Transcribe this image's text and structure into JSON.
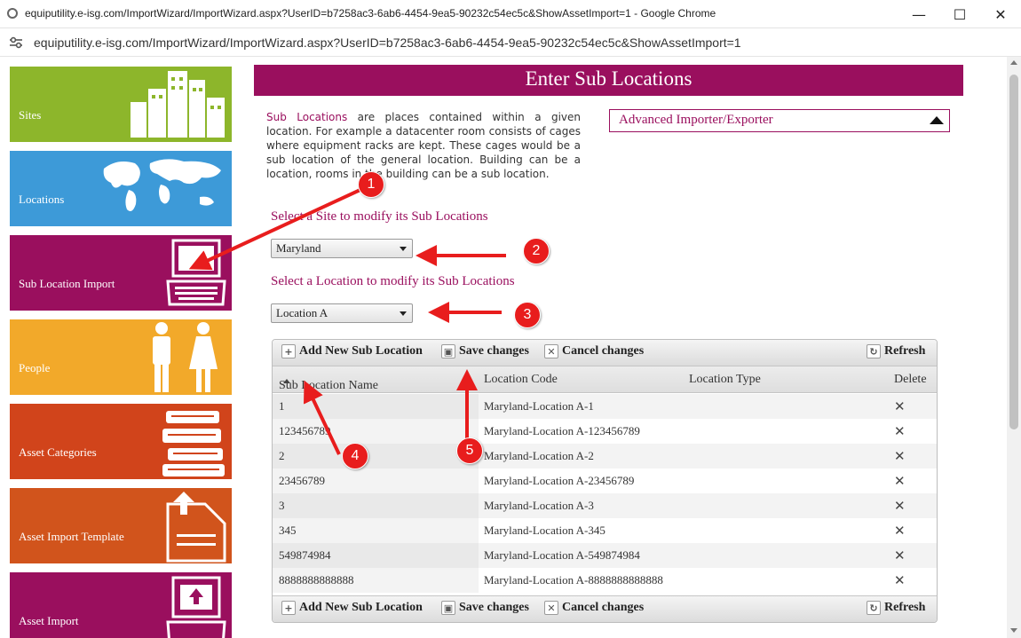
{
  "browser": {
    "window_title": "equiputility.e-isg.com/ImportWizard/ImportWizard.aspx?UserID=b7258ac3-6ab6-4454-9ea5-90232c54ec5c&ShowAssetImport=1 - Google Chrome",
    "url": "equiputility.e-isg.com/ImportWizard/ImportWizard.aspx?UserID=b7258ac3-6ab6-4454-9ea5-90232c54ec5c&ShowAssetImport=1",
    "controls": {
      "minimize": "—",
      "maximize": "☐",
      "close": "✕"
    }
  },
  "sidebar": {
    "tiles": [
      {
        "label": "Sites",
        "color": "#8db62b",
        "icon": "buildings-icon"
      },
      {
        "label": "Locations",
        "color": "#3d9ad8",
        "icon": "world-map-icon"
      },
      {
        "label": "Sub Location Import",
        "color": "#9a0f5e",
        "icon": "computer-icon"
      },
      {
        "label": "People",
        "color": "#f2a92a",
        "icon": "people-icon"
      },
      {
        "label": "Asset Categories",
        "color": "#d1441b",
        "icon": "books-icon"
      },
      {
        "label": "Asset Import Template",
        "color": "#d1541c",
        "icon": "upload-document-icon"
      },
      {
        "label": "Asset Import",
        "color": "#9a0f5e",
        "icon": "upload-computer-icon"
      }
    ]
  },
  "main": {
    "title": "Enter Sub Locations",
    "intro": {
      "link_text": "Sub Locations",
      "text": " are places contained within a given location. For example a datacenter room consists of cages where equipment racks are kept. These cages would be a sub location of the general location. Building can be a location, rooms in the building can be a sub location."
    },
    "advanced": {
      "label": "Advanced Importer/Exporter"
    },
    "site_prompt": "Select a Site to modify its Sub Locations",
    "site_value": "Maryland",
    "location_prompt": "Select a Location to modify its Sub Locations",
    "location_value": "Location A",
    "toolbar": {
      "add": "Add New Sub Location",
      "save": "Save changes",
      "cancel": "Cancel changes",
      "refresh": "Refresh"
    },
    "columns": [
      "Sub Location Name",
      "Location Code",
      "Location Type",
      "Delete"
    ],
    "rows": [
      {
        "name": "1",
        "code": "Maryland-Location A-1"
      },
      {
        "name": "123456789",
        "code": "Maryland-Location A-123456789"
      },
      {
        "name": "2",
        "code": "Maryland-Location A-2"
      },
      {
        "name": "23456789",
        "code": "Maryland-Location A-23456789"
      },
      {
        "name": "3",
        "code": "Maryland-Location A-3"
      },
      {
        "name": "345",
        "code": "Maryland-Location A-345"
      },
      {
        "name": "549874984",
        "code": "Maryland-Location A-549874984"
      },
      {
        "name": "8888888888888",
        "code": "Maryland-Location A-8888888888888"
      }
    ],
    "delete_glyph": "✕"
  },
  "callouts": [
    "1",
    "2",
    "3",
    "4",
    "5"
  ],
  "colors": {
    "accent": "#9a0f5e",
    "callout": "#e81d1d"
  }
}
